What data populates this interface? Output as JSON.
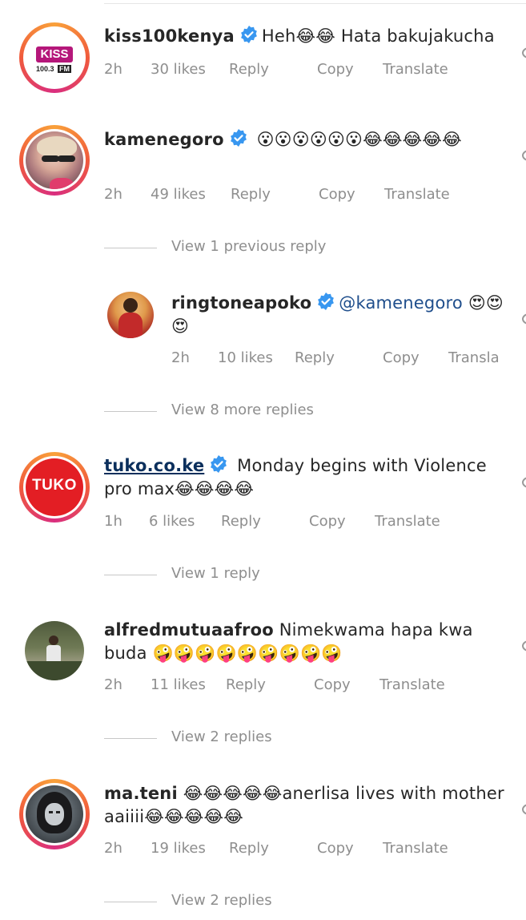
{
  "comments": [
    {
      "username": "kiss100kenya",
      "verified": true,
      "text": "Heh",
      "emoji_after": "😂😂",
      "text_after": " Hata bakujakucha",
      "age": "2h",
      "likes": "30 likes",
      "reply": "Reply",
      "copy": "Copy",
      "translate": "Translate"
    },
    {
      "username": "kamenegoro",
      "verified": true,
      "text": "😮😮😮😮😮😮😂😂😂😂😂",
      "age": "2h",
      "likes": "49 likes",
      "reply": "Reply",
      "copy": "Copy",
      "translate": "Translate",
      "view_previous": "View 1 previous reply",
      "nested_reply": {
        "username": "ringtoneapoko",
        "verified": true,
        "mention": "@kamenegoro",
        "text": "😍😍😍",
        "age": "2h",
        "likes": "10 likes",
        "reply": "Reply",
        "copy": "Copy",
        "translate": "Transla"
      },
      "view_more": "View 8 more replies"
    },
    {
      "username": "tuko.co.ke",
      "verified": true,
      "text": " Monday begins with Violence pro max😂😂😂😂",
      "age": "1h",
      "likes": "6 likes",
      "reply": "Reply",
      "copy": "Copy",
      "translate": "Translate",
      "view_replies": "View 1 reply"
    },
    {
      "username": "alfredmutuaafroo",
      "verified": false,
      "text": " Nimekwama hapa kwa buda 🤪🤪🤪🤪🤪🤪🤪🤪🤪",
      "age": "2h",
      "likes": "11 likes",
      "reply": "Reply",
      "copy": "Copy",
      "translate": "Translate",
      "view_replies": "View 2 replies"
    },
    {
      "username": "ma.teni",
      "verified": false,
      "text": " 😂😂😂😂😂anerlisa lives with mother aaiiii😂😂😂😂😂",
      "age": "2h",
      "likes": "19 likes",
      "reply": "Reply",
      "copy": "Copy",
      "translate": "Translate",
      "view_replies": "View 2 replies"
    }
  ],
  "avatars": {
    "kiss_logo": "KISS",
    "kiss_freq": "100.3",
    "kiss_fm": "FM",
    "tuko_logo": "TUKO"
  },
  "colors": {
    "verified": "#3897f0",
    "meta_text": "#8e8e8e",
    "ring_start": "#f9a13a",
    "ring_end": "#d92e7f",
    "tuko_red": "#e31e24",
    "kiss_magenta": "#b5177a"
  }
}
